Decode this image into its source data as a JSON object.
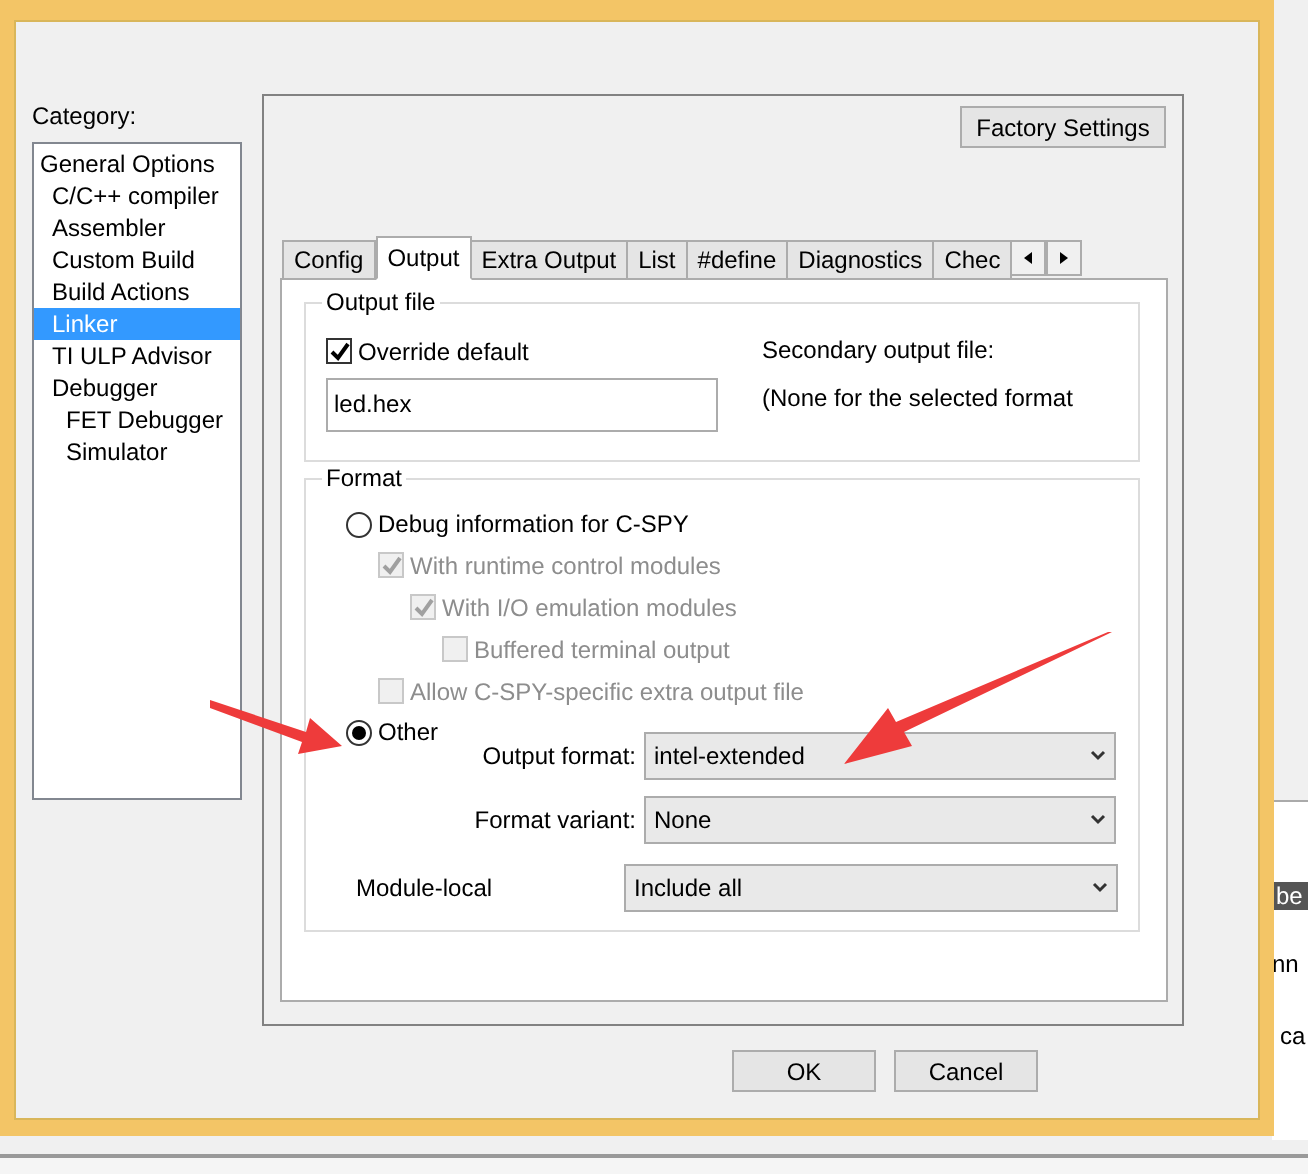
{
  "category": {
    "label": "Category:",
    "items": [
      {
        "label": "General Options",
        "kind": "group",
        "selected": false
      },
      {
        "label": "C/C++ compiler",
        "kind": "item",
        "selected": false
      },
      {
        "label": "Assembler",
        "kind": "item",
        "selected": false
      },
      {
        "label": "Custom Build",
        "kind": "item",
        "selected": false
      },
      {
        "label": "Build Actions",
        "kind": "item",
        "selected": false
      },
      {
        "label": "Linker",
        "kind": "item",
        "selected": true
      },
      {
        "label": "TI ULP Advisor",
        "kind": "item",
        "selected": false
      },
      {
        "label": "Debugger",
        "kind": "item",
        "selected": false,
        "children": [
          {
            "label": "FET Debugger",
            "kind": "subitem",
            "selected": false
          },
          {
            "label": "Simulator",
            "kind": "subitem",
            "selected": false
          }
        ]
      }
    ]
  },
  "factory_button": "Factory Settings",
  "tabs": [
    {
      "label": "Config",
      "selected": false
    },
    {
      "label": "Output",
      "selected": true
    },
    {
      "label": "Extra Output",
      "selected": false
    },
    {
      "label": "List",
      "selected": false
    },
    {
      "label": "#define",
      "selected": false
    },
    {
      "label": "Diagnostics",
      "selected": false
    },
    {
      "label": "Chec",
      "selected": false
    }
  ],
  "output_file": {
    "title": "Output file",
    "override": {
      "label": "Override default",
      "checked": true
    },
    "filename": "led.hex",
    "secondary_label": "Secondary output file:",
    "secondary_value": "(None for the selected format"
  },
  "format": {
    "title": "Format",
    "options": [
      {
        "label": "Debug information for C-SPY",
        "selected": false,
        "checks": [
          {
            "label": "With runtime control modules",
            "checked": true,
            "disabled": true,
            "children": [
              {
                "label": "With I/O emulation modules",
                "checked": true,
                "disabled": true,
                "children": [
                  {
                    "label": "Buffered terminal output",
                    "checked": false,
                    "disabled": true
                  }
                ]
              }
            ]
          },
          {
            "label": "Allow C-SPY-specific extra output file",
            "checked": false,
            "disabled": true
          }
        ]
      },
      {
        "label": "Other",
        "selected": true,
        "fields": [
          {
            "label": "Output format:",
            "value": "intel-extended"
          },
          {
            "label": "Format variant:",
            "value": "None"
          }
        ]
      }
    ],
    "module_local": {
      "label": "Module-local",
      "value": "Include all"
    }
  },
  "buttons": [
    "OK",
    "Cancel"
  ],
  "background_fragments": [
    "be",
    "nn",
    "ca"
  ]
}
